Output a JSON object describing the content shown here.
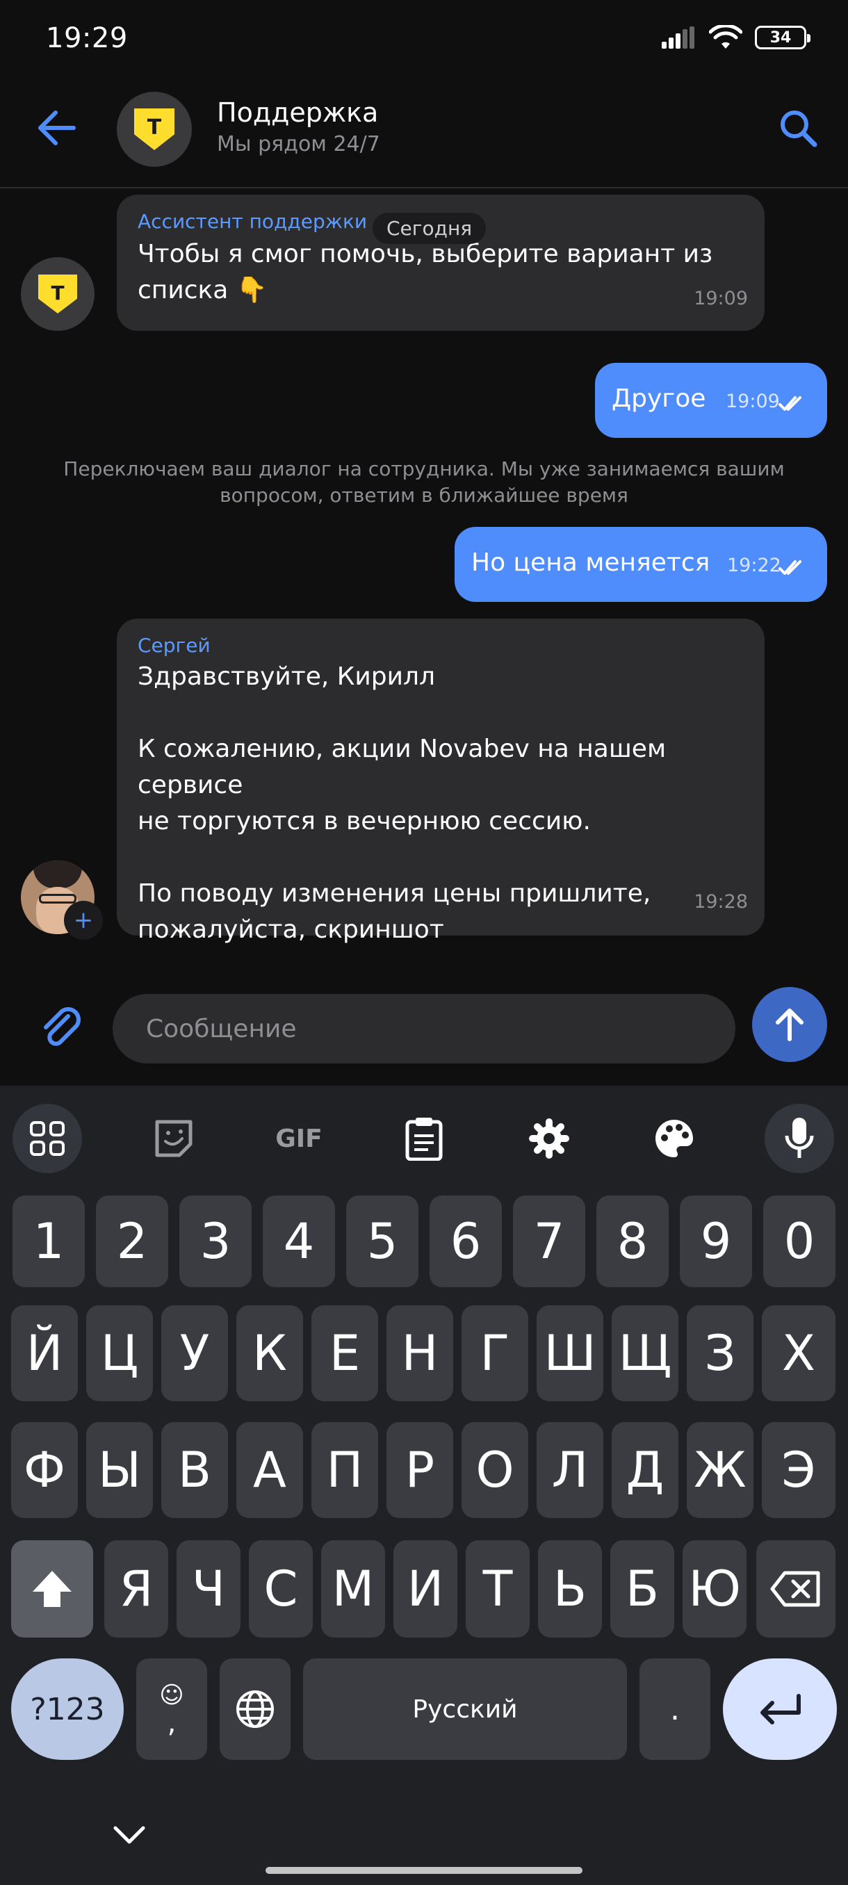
{
  "status_bar": {
    "time": "19:29",
    "battery": "34"
  },
  "header": {
    "title": "Поддержка",
    "subtitle": "Мы рядом 24/7",
    "logo_letter": "T"
  },
  "chat": {
    "date_pill": "Сегодня",
    "messages": [
      {
        "sender": "Ассистент поддержки",
        "text": "Чтобы я смог помочь, выберите вариант из\nсписка 👇",
        "time": "19:09"
      },
      {
        "text": "Другое",
        "time": "19:09"
      },
      {
        "system": "Переключаем ваш диалог на сотрудника. Мы уже занимаемся вашим\nвопросом, ответим в ближайшее время"
      },
      {
        "text": "Но цена меняется",
        "time": "19:22"
      },
      {
        "sender": "Сергей",
        "text": "Здравствуйте, Кирилл\n\nК сожалению, акции Novabev на нашем сервисе\nне торгуются в вечернюю сессию.\n\nПо поводу изменения цены пришлите,\nпожалуйста, скриншот",
        "time": "19:28"
      }
    ]
  },
  "composer": {
    "placeholder": "Сообщение"
  },
  "keyboard": {
    "toolbar": {
      "gif": "GIF"
    },
    "row1": [
      "1",
      "2",
      "3",
      "4",
      "5",
      "6",
      "7",
      "8",
      "9",
      "0"
    ],
    "row2": [
      "Й",
      "Ц",
      "У",
      "К",
      "Е",
      "Н",
      "Г",
      "Ш",
      "Щ",
      "З",
      "Х"
    ],
    "row3": [
      "Ф",
      "Ы",
      "В",
      "А",
      "П",
      "Р",
      "О",
      "Л",
      "Д",
      "Ж",
      "Э"
    ],
    "row4": [
      "Я",
      "Ч",
      "С",
      "М",
      "И",
      "Т",
      "Ь",
      "Б",
      "Ю"
    ],
    "symbols_key": "?123",
    "emoji_key_sub": ",",
    "space_label": "Русский",
    "period_key": "."
  },
  "colors": {
    "accent": "#4f8dfc",
    "logo_yellow": "#ffdd2d",
    "incoming": "#2c2c2e"
  }
}
